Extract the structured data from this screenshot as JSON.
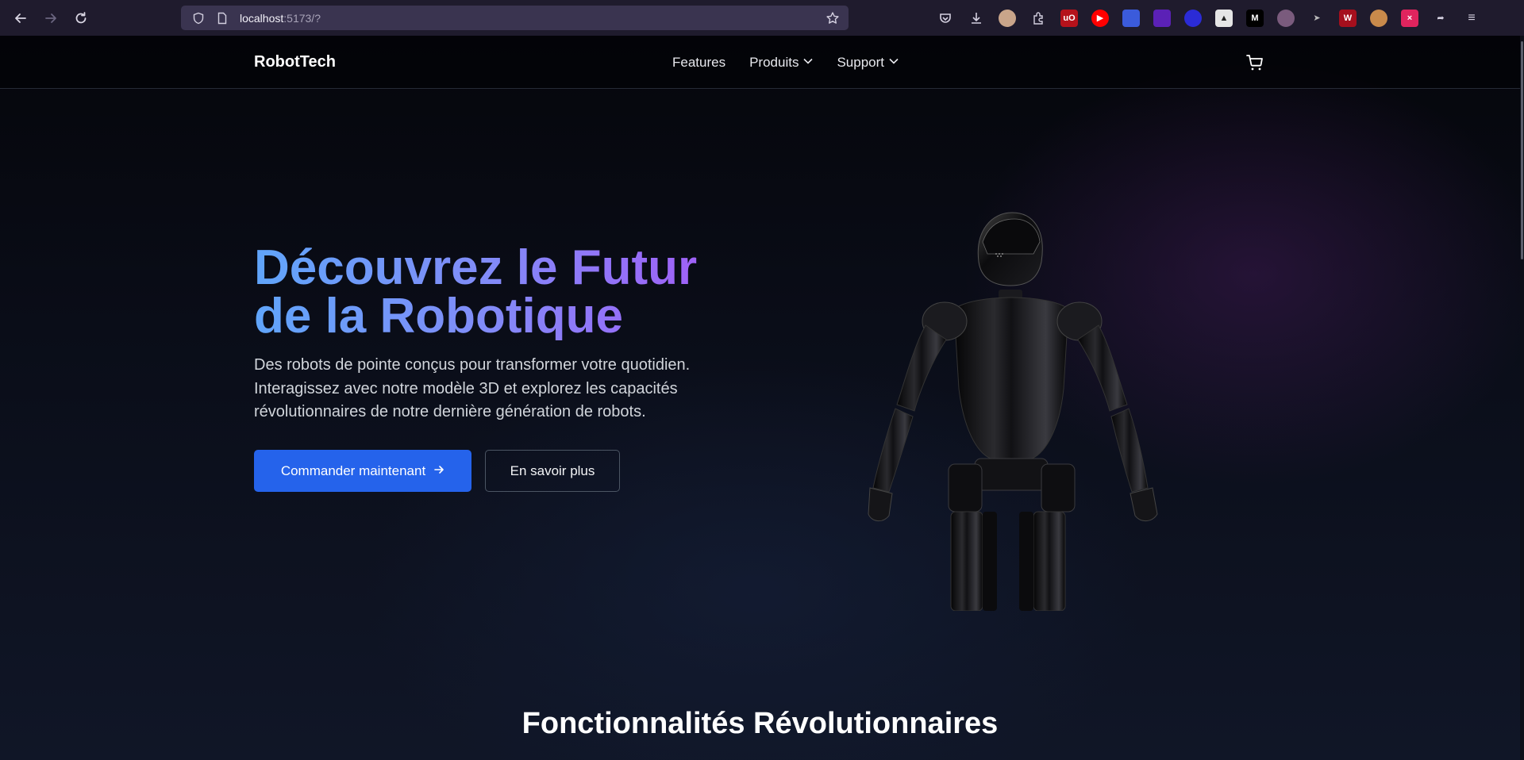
{
  "browser": {
    "url_host": "localhost",
    "url_rest": ":5173/?"
  },
  "header": {
    "logo": "RobotTech",
    "menu": [
      {
        "label": "Features",
        "has_dropdown": false
      },
      {
        "label": "Produits",
        "has_dropdown": true
      },
      {
        "label": "Support",
        "has_dropdown": true
      }
    ],
    "cart_icon": "shopping-cart-icon"
  },
  "hero": {
    "title_line1": "Découvrez le Futur",
    "title_line2": "de la Robotique",
    "description_line1": "Des robots de pointe conçus pour transformer votre quotidien.",
    "description_line2": "Interagissez avec notre modèle 3D et explorez les capacités",
    "description_line3": "révolutionnaires de notre dernière génération de robots.",
    "primary_button": "Commander maintenant",
    "secondary_button": "En savoir plus",
    "gradient_start": "#60a5fa",
    "gradient_end": "#a855f7"
  },
  "features": {
    "title": "Fonctionnalités Révolutionnaires"
  },
  "colors": {
    "primary": "#2563eb",
    "background": "#0b0d16"
  }
}
